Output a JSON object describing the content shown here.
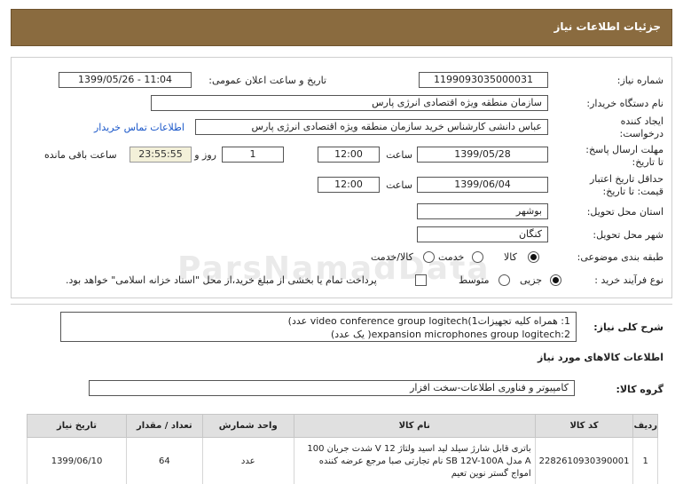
{
  "header": {
    "title": "جزئیات اطلاعات نیاز"
  },
  "watermark": "ParsNamadData",
  "form": {
    "need_number_label": "شماره نیاز:",
    "need_number": "1199093035000031",
    "announce_label": "تاریخ و ساعت اعلان عمومی:",
    "announce_value": "1399/05/26 - 11:04",
    "buyer_org_label": "نام دستگاه خریدار:",
    "buyer_org": "سازمان منطقه ویژه اقتصادی انرژی پارس",
    "requester_label_1": "ایجاد کننده",
    "requester_label_2": "درخواست:",
    "requester": "عباس دانشی کارشناس خرید سازمان منطقه ویژه اقتصادی انرژی پارس",
    "contact_link": "اطلاعات تماس خریدار",
    "deadline_label_1": "مهلت ارسال پاسخ:",
    "deadline_label_2": "تا تاریخ:",
    "deadline_date": "1399/05/28",
    "time_label": "ساعت",
    "deadline_time": "12:00",
    "days_value": "1",
    "days_label": "روز و",
    "remaining_time": "23:55:55",
    "remaining_label": "ساعت باقی مانده",
    "validity_label_1": "حداقل تاریخ اعتبار",
    "validity_label_2": "قیمت: تا تاریخ:",
    "validity_date": "1399/06/04",
    "validity_time_label": "ساعت",
    "validity_time": "12:00",
    "province_label": "استان محل تحویل:",
    "province": "بوشهر",
    "city_label": "شهر محل تحویل:",
    "city": "کنگان",
    "category_label": "طبقه بندی موضوعی:",
    "category_options": [
      "کالا",
      "خدمت",
      "کالا/خدمت"
    ],
    "process_label": "نوع فرآیند خرید :",
    "process_options": [
      "جزیی",
      "متوسط"
    ],
    "payment_note": "پرداخت تمام یا بخشی از مبلغ خرید،از محل \"اسناد خزانه اسلامی\" خواهد بود."
  },
  "description": {
    "label": "شرح کلی نیاز:",
    "line1": "1: همراه کلیه تجهیزات1)video conference group logitech عدد)",
    "line2": "expansion microphones group logitech:2( یک عدد)"
  },
  "goods": {
    "section_title": "اطلاعات کالاهای مورد نیاز",
    "group_label": "گروه کالا:",
    "group_value": "کامپیوتر و فناوری اطلاعات-سخت افزار",
    "columns": [
      "ردیف",
      "کد کالا",
      "نام کالا",
      "واحد شمارش",
      "تعداد / مقدار",
      "تاریخ نیاز"
    ],
    "rows": [
      {
        "row": "1",
        "code": "2282610930390001",
        "name_line1": "باتری قابل شارژ سیلد لید اسید ولتاژ 12 V شدت جریان 100",
        "name_line2": "A مدل SB 12V-100A نام تجارتی صبا مرجع عرضه کننده",
        "name_line3": "امواج گستر نوین تعیم",
        "unit": "عدد",
        "qty": "64",
        "date": "1399/06/10"
      }
    ]
  }
}
